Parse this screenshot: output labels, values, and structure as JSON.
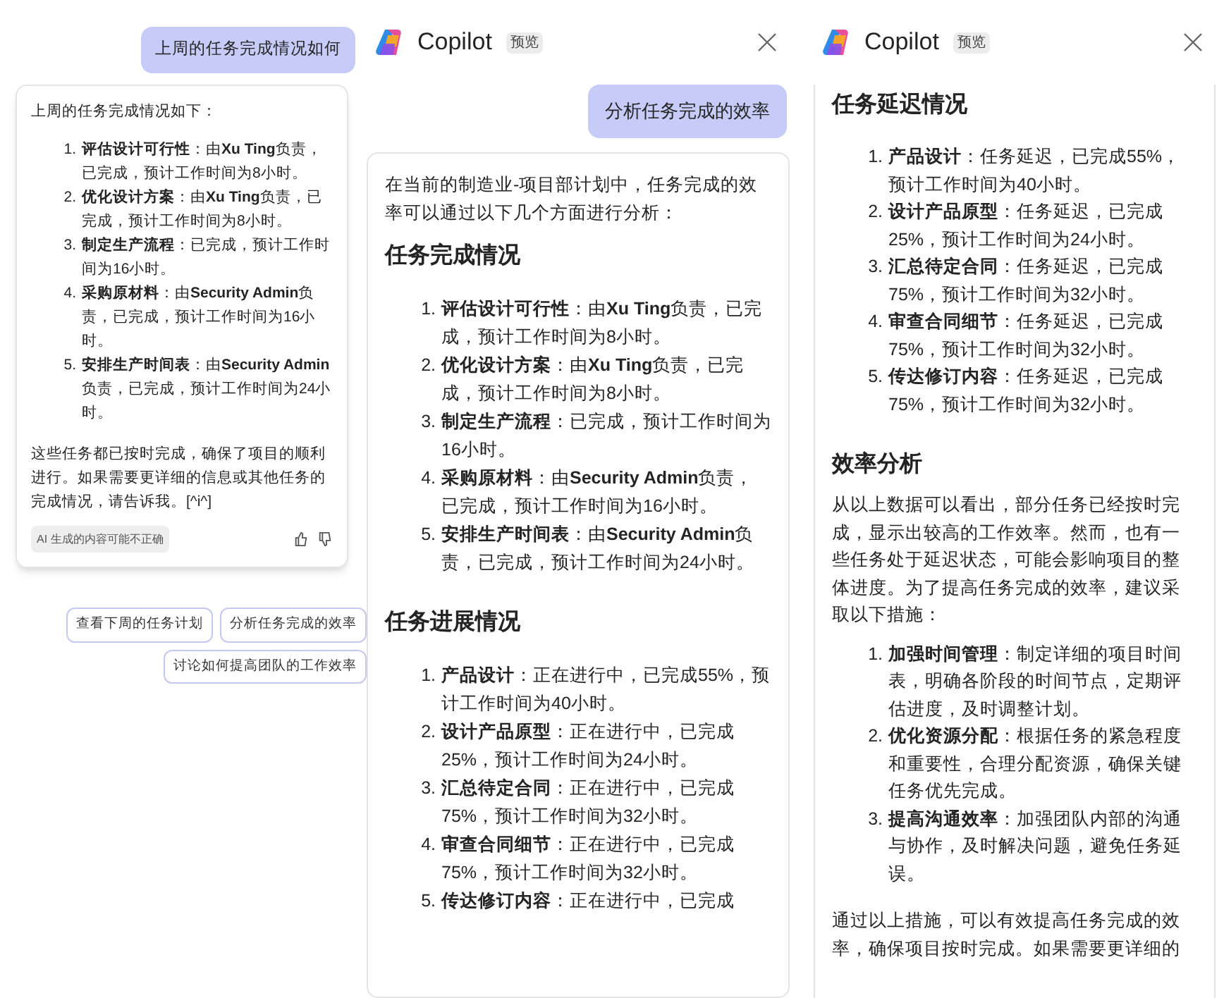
{
  "panels": [
    {
      "user_message": "上周的任务完成情况如何",
      "response": {
        "intro": "上周的任务完成情况如下：",
        "items": [
          {
            "number": "1.",
            "text": "**评估设计可行性**：由**Xu Ting**负责，已完成，预计工作时间为8小时。"
          },
          {
            "number": "2.",
            "text": "**优化设计方案**：由**Xu Ting**负责，已完成，预计工作时间为8小时。"
          },
          {
            "number": "3.",
            "text": "**制定生产流程**：已完成，预计工作时间为16小时。"
          },
          {
            "number": "4.",
            "text": "**采购原材料**：由**Security Admin**负责，已完成，预计工作时间为16小时。"
          },
          {
            "number": "5.",
            "text": "**安排生产时间表**：由**Security Admin**负责，已完成，预计工作时间为24小时。"
          }
        ],
        "outro": "这些任务都已按时完成，确保了项目的顺利进行。如果需要更详细的信息或其他任务的完成情况，请告诉我。[^i^]",
        "disclaimer": "AI 生成的内容可能不正确"
      },
      "suggestions": [
        "查看下周的任务计划",
        "分析任务完成的效率",
        "讨论如何提高团队的工作效率"
      ]
    },
    {
      "header": {
        "title": "Copilot",
        "badge": "预览"
      },
      "user_message": "分析任务完成的效率",
      "response": {
        "intro": "在当前的制造业-项目部计划中，任务完成的效率可以通过以下几个方面进行分析：",
        "sections": [
          {
            "heading": "任务完成情况",
            "items": [
              {
                "number": "1.",
                "text": "**评估设计可行性**：由**Xu Ting**负责，已完成，预计工作时间为8小时。"
              },
              {
                "number": "2.",
                "text": "**优化设计方案**：由**Xu Ting**负责，已完成，预计工作时间为8小时。"
              },
              {
                "number": "3.",
                "text": "**制定生产流程**：已完成，预计工作时间为16小时。"
              },
              {
                "number": "4.",
                "text": "**采购原材料**：由**Security Admin**负责，已完成，预计工作时间为16小时。"
              },
              {
                "number": "5.",
                "text": "**安排生产时间表**：由**Security Admin**负责，已完成，预计工作时间为24小时。"
              }
            ]
          },
          {
            "heading": "任务进展情况",
            "items": [
              {
                "number": "1.",
                "text": "**产品设计**：正在进行中，已完成55%，预计工作时间为40小时。"
              },
              {
                "number": "2.",
                "text": "**设计产品原型**：正在进行中，已完成25%，预计工作时间为24小时。"
              },
              {
                "number": "3.",
                "text": "**汇总待定合同**：正在进行中，已完成75%，预计工作时间为32小时。"
              },
              {
                "number": "4.",
                "text": "**审查合同细节**：正在进行中，已完成75%，预计工作时间为32小时。"
              },
              {
                "number": "5.",
                "text": "**传达修订内容**：正在进行中，已完成"
              }
            ]
          }
        ]
      }
    },
    {
      "header": {
        "title": "Copilot",
        "badge": "预览"
      },
      "response": {
        "sections": [
          {
            "heading": "任务延迟情况",
            "items": [
              {
                "number": "1.",
                "text": "**产品设计**：任务延迟，已完成55%，预计工作时间为40小时。"
              },
              {
                "number": "2.",
                "text": "**设计产品原型**：任务延迟，已完成25%，预计工作时间为24小时。"
              },
              {
                "number": "3.",
                "text": "**汇总待定合同**：任务延迟，已完成75%，预计工作时间为32小时。"
              },
              {
                "number": "4.",
                "text": "**审查合同细节**：任务延迟，已完成75%，预计工作时间为32小时。"
              },
              {
                "number": "5.",
                "text": "**传达修订内容**：任务延迟，已完成75%，预计工作时间为32小时。"
              }
            ]
          },
          {
            "heading": "效率分析",
            "paragraph": "从以上数据可以看出，部分任务已经按时完成，显示出较高的工作效率。然而，也有一些任务处于延迟状态，可能会影响项目的整体进度。为了提高任务完成的效率，建议采取以下措施：",
            "items": [
              {
                "number": "1.",
                "text": "**加强时间管理**：制定详细的项目时间表，明确各阶段的时间节点，定期评估进度，及时调整计划。"
              },
              {
                "number": "2.",
                "text": "**优化资源分配**：根据任务的紧急程度和重要性，合理分配资源，确保关键任务优先完成。"
              },
              {
                "number": "3.",
                "text": "**提高沟通效率**：加强团队内部的沟通与协作，及时解决问题，避免任务延误。"
              }
            ]
          }
        ],
        "outro": "通过以上措施，可以有效提高任务完成的效率，确保项目按时完成。如果需要更详细的"
      }
    }
  ]
}
